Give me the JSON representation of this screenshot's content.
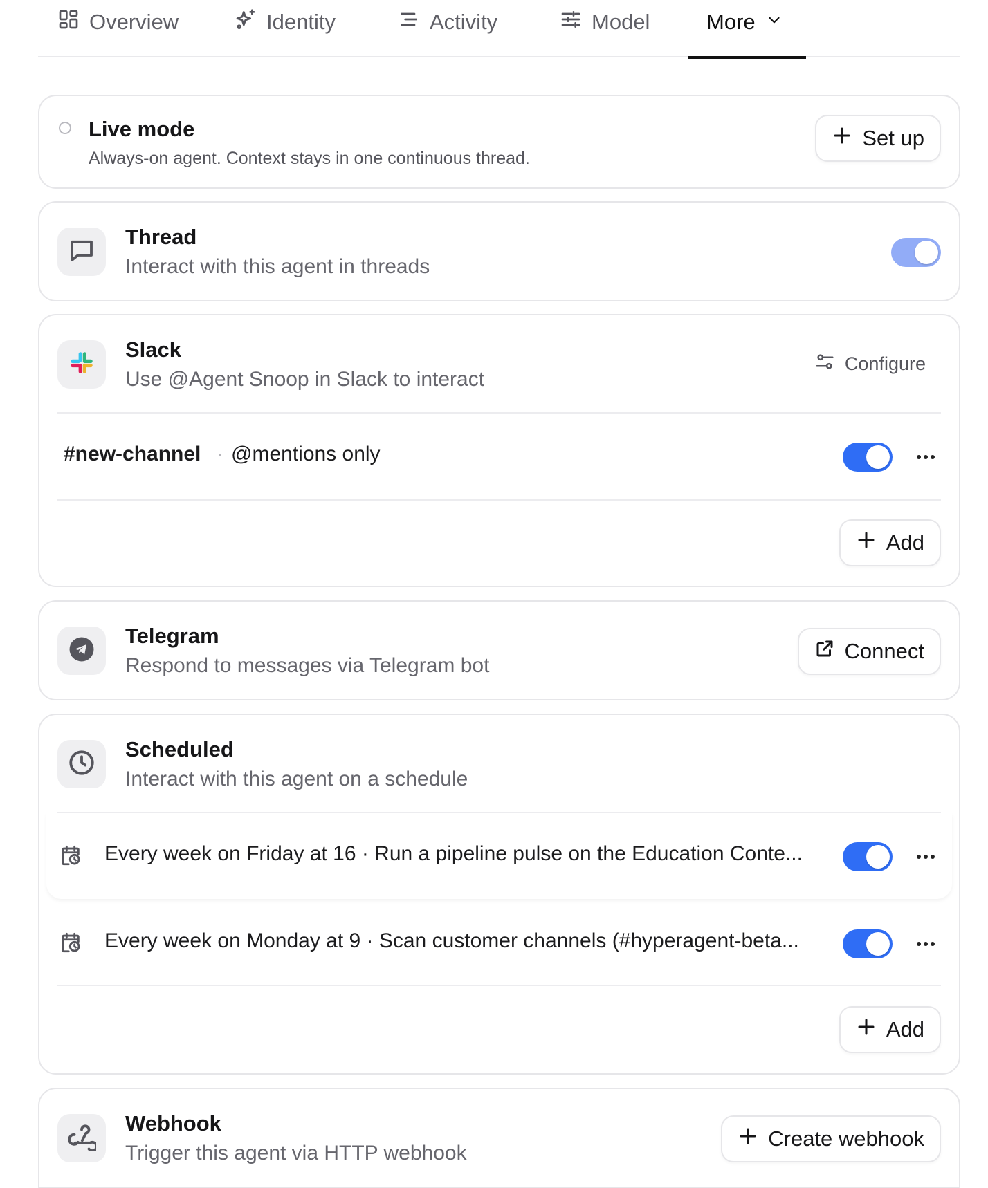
{
  "tabs": [
    {
      "label": "Overview",
      "icon": "layout-grid-icon"
    },
    {
      "label": "Identity",
      "icon": "sparkles-icon"
    },
    {
      "label": "Activity",
      "icon": "list-icon"
    },
    {
      "label": "Model",
      "icon": "sliders-icon"
    },
    {
      "label": "More",
      "icon": "chevron-down-icon",
      "active": true
    }
  ],
  "live_mode": {
    "title": "Live mode",
    "description": "Always-on agent. Context stays in one continuous thread.",
    "button": "Set up"
  },
  "thread": {
    "title": "Thread",
    "description": "Interact with this agent in threads",
    "enabled": true
  },
  "slack": {
    "title": "Slack",
    "description": "Use @Agent Snoop in Slack to interact",
    "configure": "Configure",
    "channels": [
      {
        "name": "#new-channel",
        "separator": "·",
        "mode": "@mentions only",
        "enabled": true
      }
    ],
    "add": "Add"
  },
  "telegram": {
    "title": "Telegram",
    "description": "Respond to messages via Telegram bot",
    "button": "Connect"
  },
  "scheduled": {
    "title": "Scheduled",
    "description": "Interact with this agent on a schedule",
    "items": [
      {
        "text": "Every week on Friday at 16 · Run a pipeline pulse on the Education Conte...",
        "enabled": true
      },
      {
        "text": "Every week on Monday at 9 · Scan customer channels (#hyperagent-beta...",
        "enabled": true
      }
    ],
    "add": "Add"
  },
  "webhook": {
    "title": "Webhook",
    "description": "Trigger this agent via HTTP webhook",
    "button": "Create webhook"
  },
  "colors": {
    "accent": "#2f6df5",
    "toggle_faded": "#92acf7",
    "border": "#e6e6e9",
    "muted_text": "#66666d"
  }
}
